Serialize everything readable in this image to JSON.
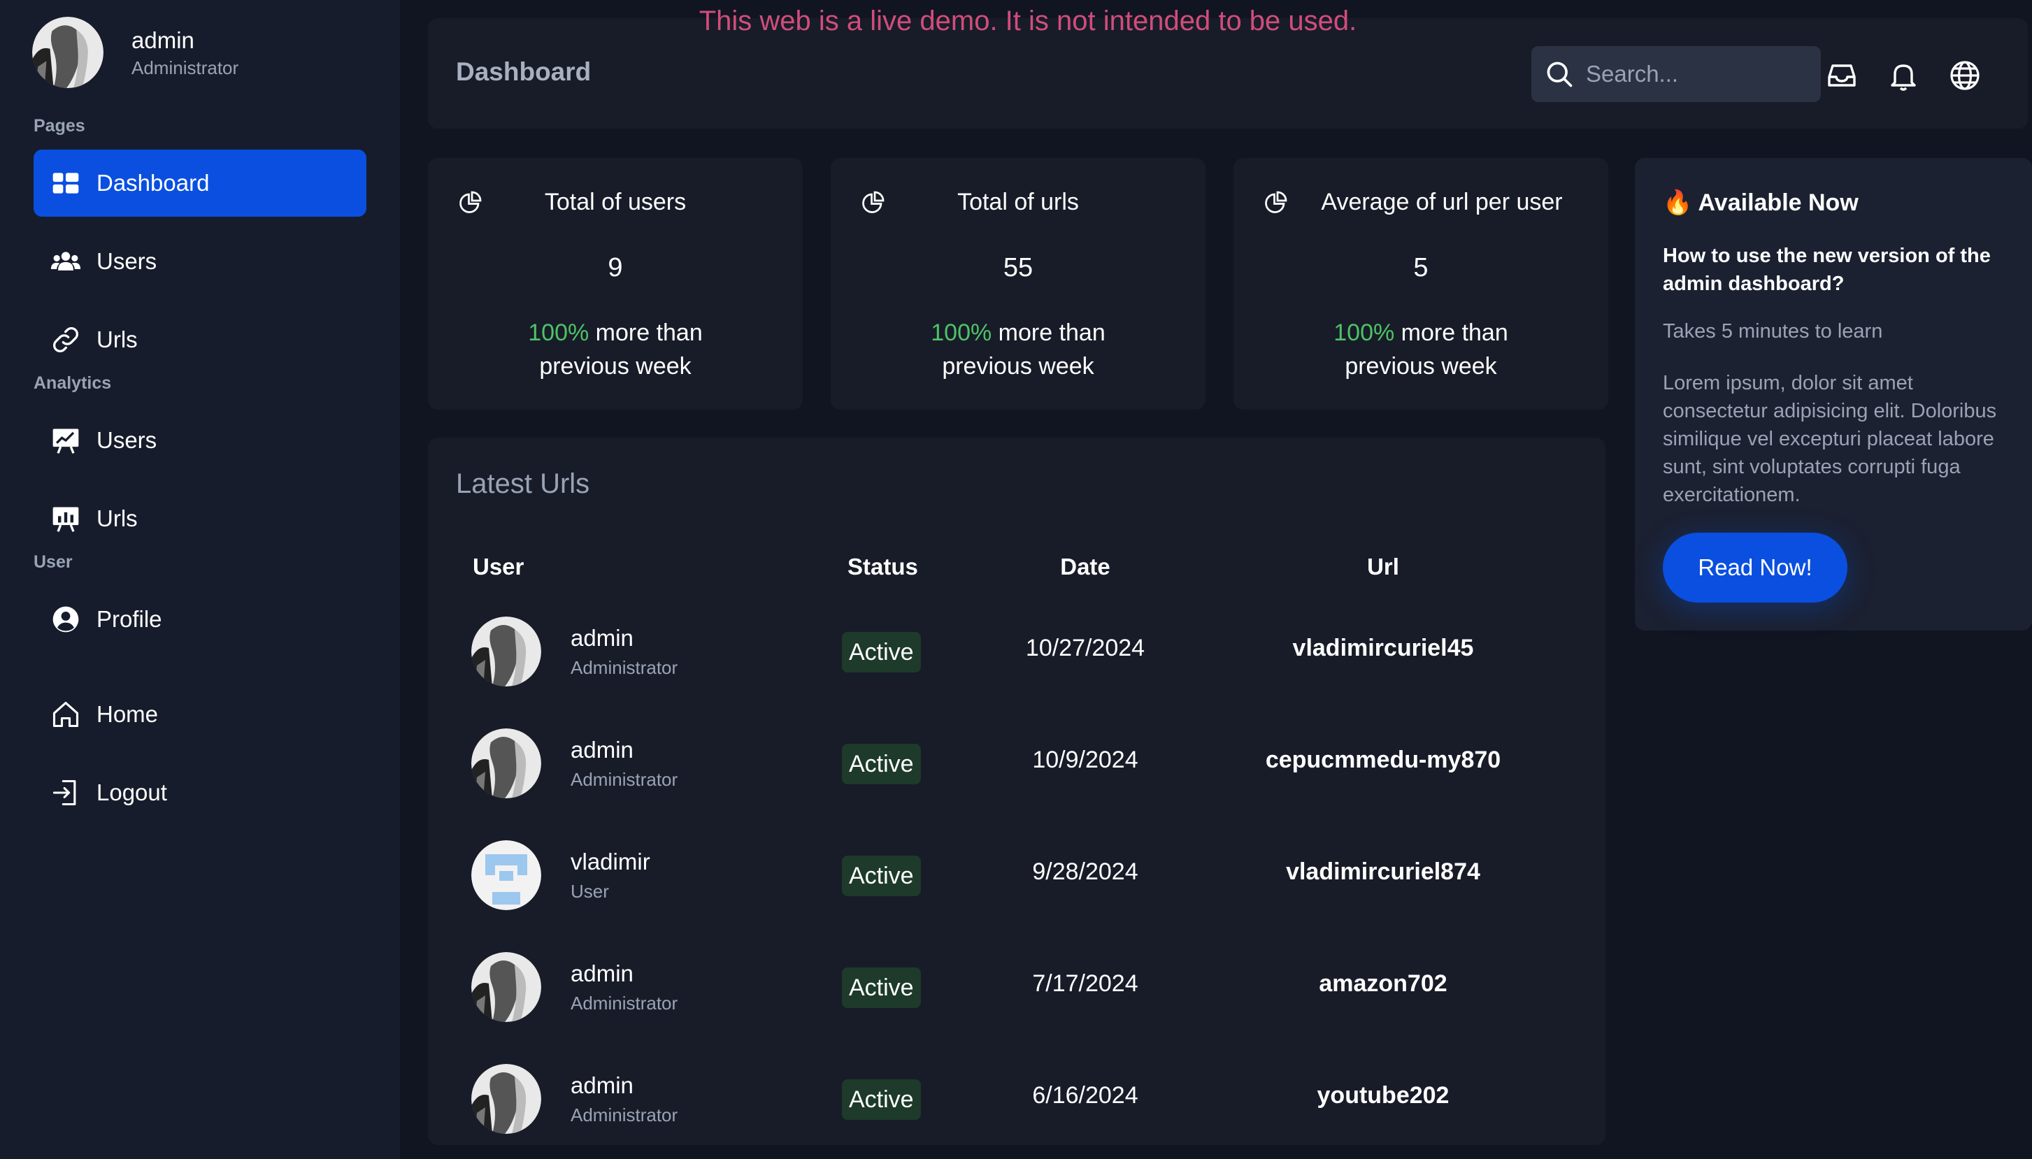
{
  "banner": "This web is a live demo. It is not intended to be used.",
  "current_user": {
    "name": "admin",
    "role": "Administrator"
  },
  "sidebar": {
    "sections": [
      "Pages",
      "Analytics",
      "User"
    ],
    "items": [
      {
        "label": "Dashboard",
        "icon": "dashboard-icon",
        "active": true
      },
      {
        "label": "Users",
        "icon": "users-icon"
      },
      {
        "label": "Urls",
        "icon": "link-icon"
      },
      {
        "label": "Users",
        "icon": "chart-board-icon"
      },
      {
        "label": "Urls",
        "icon": "bar-chart-board-icon"
      },
      {
        "label": "Profile",
        "icon": "user-circle-icon"
      },
      {
        "label": "Home",
        "icon": "home-icon"
      },
      {
        "label": "Logout",
        "icon": "logout-icon"
      }
    ]
  },
  "header": {
    "title": "Dashboard",
    "search_placeholder": "Search...",
    "icons": [
      "inbox-icon",
      "bell-icon",
      "globe-icon"
    ]
  },
  "stats": [
    {
      "title": "Total of users",
      "value": "9",
      "pct": "100%",
      "trend_text": " more than previous week"
    },
    {
      "title": "Total of urls",
      "value": "55",
      "pct": "100%",
      "trend_text": " more than previous week"
    },
    {
      "title": "Average of url per user",
      "value": "5",
      "pct": "100%",
      "trend_text": " more than previous week"
    }
  ],
  "promo": {
    "title": "🔥 Available Now",
    "question": "How to use the new version of the admin dashboard?",
    "time": "Takes 5 minutes to learn",
    "body": "Lorem ipsum, dolor sit amet consectetur adipisicing elit. Doloribus similique vel excepturi placeat labore sunt, sint voluptates corrupti fuga exercitationem.",
    "button": "Read Now!"
  },
  "latest_urls": {
    "title": "Latest Urls",
    "columns": [
      "User",
      "Status",
      "Date",
      "Url"
    ],
    "rows": [
      {
        "name": "admin",
        "role": "Administrator",
        "status": "Active",
        "date": "10/27/2024",
        "url": "vladimircuriel45",
        "avatar": "sketch"
      },
      {
        "name": "admin",
        "role": "Administrator",
        "status": "Active",
        "date": "10/9/2024",
        "url": "cepucmmedu-my870",
        "avatar": "sketch"
      },
      {
        "name": "vladimir",
        "role": "User",
        "status": "Active",
        "date": "9/28/2024",
        "url": "vladimircuriel874",
        "avatar": "pixel"
      },
      {
        "name": "admin",
        "role": "Administrator",
        "status": "Active",
        "date": "7/17/2024",
        "url": "amazon702",
        "avatar": "sketch"
      },
      {
        "name": "admin",
        "role": "Administrator",
        "status": "Active",
        "date": "6/16/2024",
        "url": "youtube202",
        "avatar": "sketch"
      }
    ]
  },
  "colors": {
    "accent": "#0a4fe0",
    "positive": "#4fc267",
    "banner": "#d14d7b",
    "badge_bg": "#1d3a2a"
  }
}
